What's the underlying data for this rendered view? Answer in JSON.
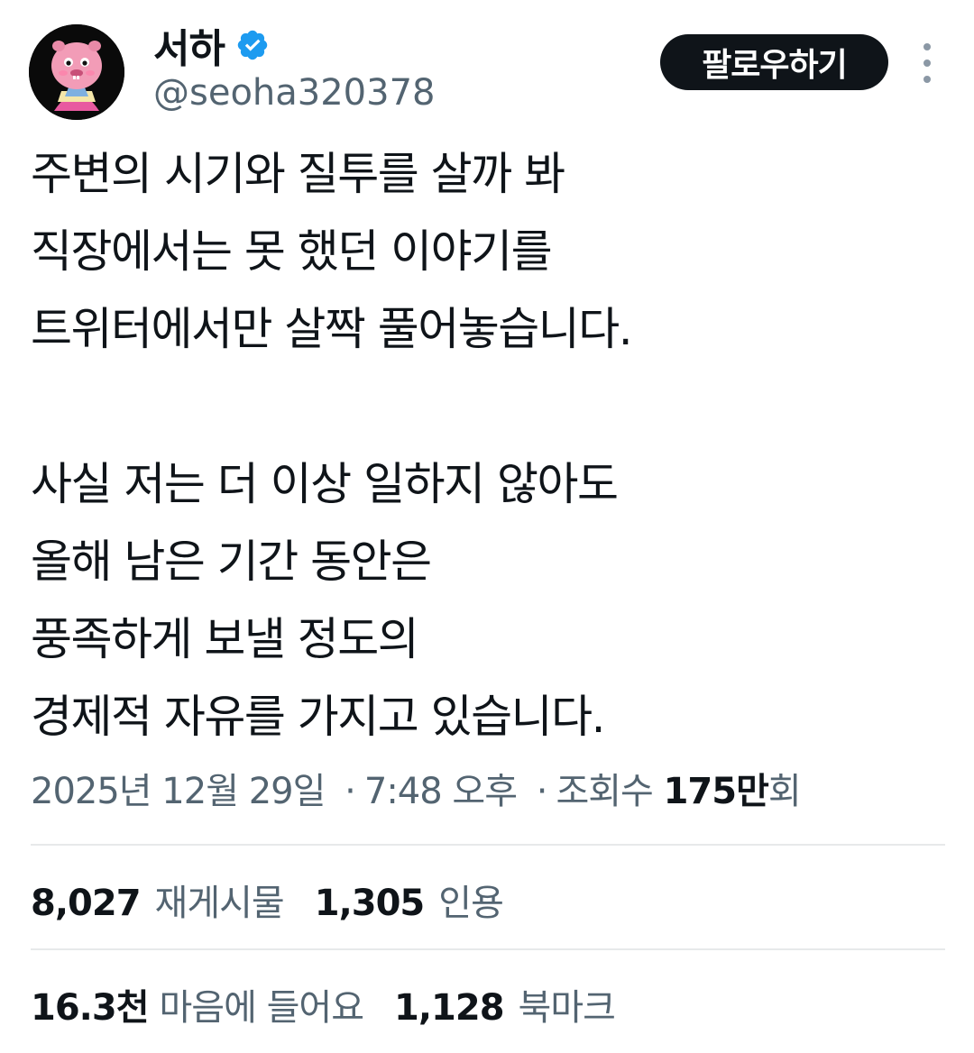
{
  "author": {
    "display_name": "서하",
    "handle": "@seoha320378",
    "verified_icon": "verified-badge-icon",
    "verified_color": "#1d9bf0"
  },
  "actions": {
    "follow_label": "팔로우하기",
    "more_icon": "more-vertical-icon"
  },
  "tweet": {
    "lines": [
      "주변의 시기와 질투를 살까 봐",
      "직장에서는 못 했던 이야기를",
      "트위터에서만 살짝 풀어놓습니다.",
      "",
      "사실 저는 더 이상 일하지 않아도",
      "올해 남은 기간 동안은",
      "풍족하게 보낼 정도의",
      "경제적 자유를 가지고 있습니다."
    ]
  },
  "meta": {
    "date": "2025년 12월 29일",
    "separator": "·",
    "time": "7:48 오후",
    "views_label": "조회수",
    "views_count": "175만",
    "views_suffix": "회"
  },
  "stats": {
    "retweets": {
      "count": "8,027",
      "label": "재게시물"
    },
    "quotes": {
      "count": "1,305",
      "label": "인용"
    },
    "likes": {
      "count": "16.3천",
      "label": "마음에 들어요"
    },
    "bookmarks": {
      "count": "1,128",
      "label": "북마크"
    }
  },
  "colors": {
    "text_primary": "#0f1419",
    "text_secondary": "#536471",
    "divider": "#e7e9ea",
    "button_bg": "#0f1419"
  }
}
